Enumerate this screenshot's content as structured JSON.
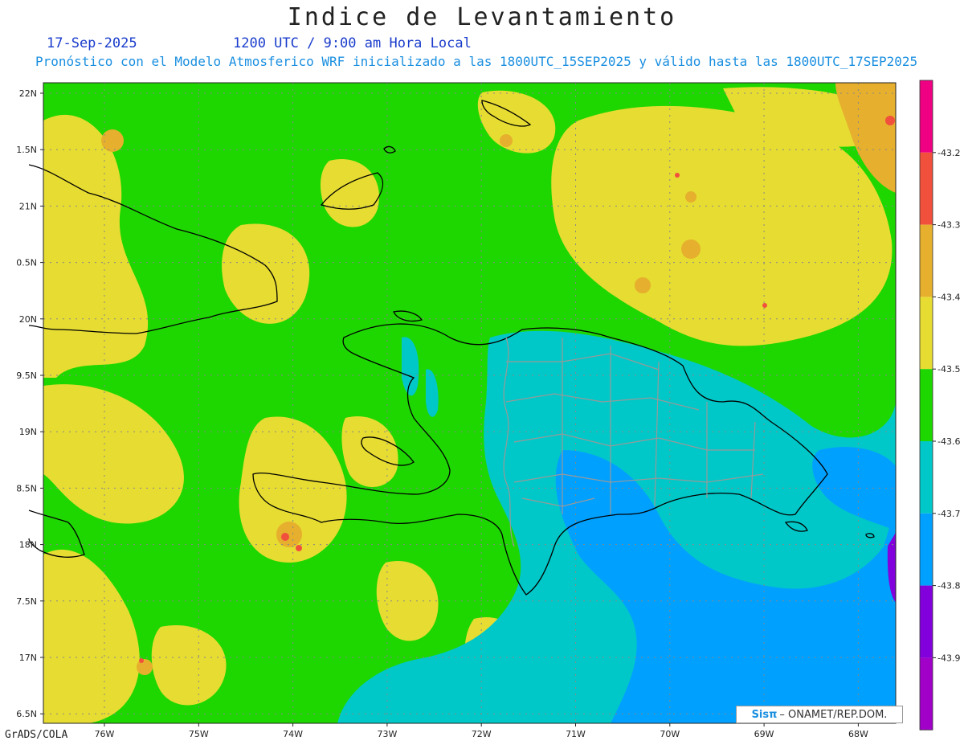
{
  "title": "Indice de Levantamiento",
  "date": "17-Sep-2025",
  "time": "1200 UTC / 9:00 am Hora Local",
  "description": "Pronóstico con el Modelo Atmosferico WRF inicializado a las 1800UTC_15SEP2025 y válido hasta las  1800UTC_17SEP2025",
  "footer": "GrADS/COLA",
  "credit": {
    "logo": "Sisπ",
    "text": "– ONAMET/REP.DOM."
  },
  "map": {
    "lat_labels": [
      "22N",
      "1.5N",
      "21N",
      "0.5N",
      "20N",
      "9.5N",
      "19N",
      "8.5N",
      "18N",
      "7.5N",
      "17N",
      "6.5N"
    ],
    "lon_labels": [
      "76W",
      "75W",
      "74W",
      "73W",
      "72W",
      "71W",
      "70W",
      "69W",
      "68W"
    ],
    "colors": {
      "yellow": "#e6dc32",
      "green": "#1ed700",
      "cyan": "#00c8c8",
      "blue": "#00a0ff",
      "orange": "#e6af2d",
      "red": "#f0503c",
      "purple": "#8200dc",
      "magenta": "#f00082",
      "coast": "#000000",
      "provinces": "#999999"
    }
  },
  "colorbar": {
    "labels": [
      "-43.2",
      "-43.3",
      "-43.4",
      "-43.5",
      "-43.6",
      "-43.7",
      "-43.8",
      "-43.9"
    ],
    "colors": [
      "#f00082",
      "#f0503c",
      "#e6af2d",
      "#e6dc32",
      "#1ed700",
      "#00c8c8",
      "#00a0ff",
      "#8200dc",
      "#a000c8"
    ]
  }
}
